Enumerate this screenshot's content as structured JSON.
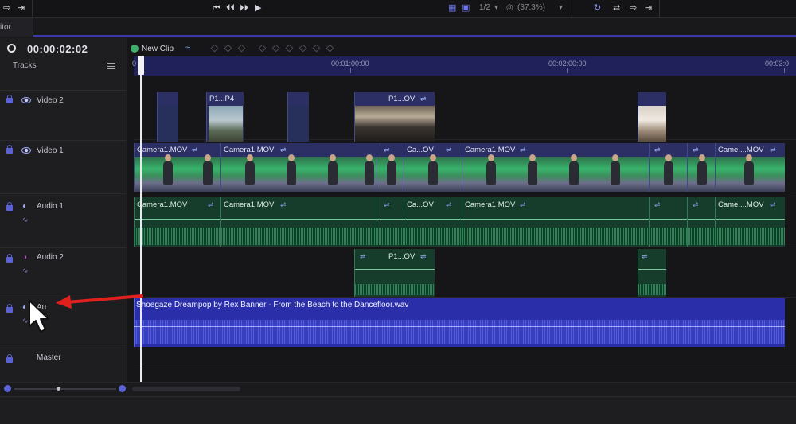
{
  "transport": {
    "skip_start_icon": "skip-back-icon",
    "step_back_icon": "frame-back-icon",
    "step_fwd_icon": "frame-forward-icon",
    "play_icon": "play-icon",
    "resolution": "1/2",
    "zoom_percent": "(37.3%)"
  },
  "editor_tab": {
    "label": "itor"
  },
  "timeline": {
    "timecode": "00:00:02:02",
    "tracks_label": "Tracks",
    "new_clip_label": "New Clip",
    "ruler_labels": [
      "0",
      "00:01:00:00",
      "00:02:00:00",
      "00:03:0"
    ],
    "tracks": [
      {
        "name": "Video 2",
        "type": "video"
      },
      {
        "name": "Video 1",
        "type": "video"
      },
      {
        "name": "Audio 1",
        "type": "audio"
      },
      {
        "name": "Audio 2",
        "type": "audio"
      },
      {
        "name": "Au",
        "type": "audio"
      },
      {
        "name": "Master",
        "type": "master"
      }
    ],
    "video2_clips": [
      "P1...P4",
      "P1...OV"
    ],
    "video1_clips": [
      "Camera1.MOV",
      "Camera1.MOV",
      "Ca...OV",
      "Camera1.MOV",
      "Came....MOV"
    ],
    "audio1_clips": [
      "Camera1.MOV",
      "Camera1.MOV",
      "Ca...OV",
      "Camera1.MOV",
      "Came....MOV"
    ],
    "audio2_clips": [
      "P1...OV"
    ],
    "music_clip": "Shoegaze Dreampop by Rex Banner - From the Beach to the Dancefloor.wav"
  },
  "colors": {
    "accent": "#5b62d6",
    "video_clip": "#27305a",
    "audio_clip": "#163d2c",
    "music_clip": "#2a2ea8",
    "annotation_arrow": "#e0201c"
  }
}
